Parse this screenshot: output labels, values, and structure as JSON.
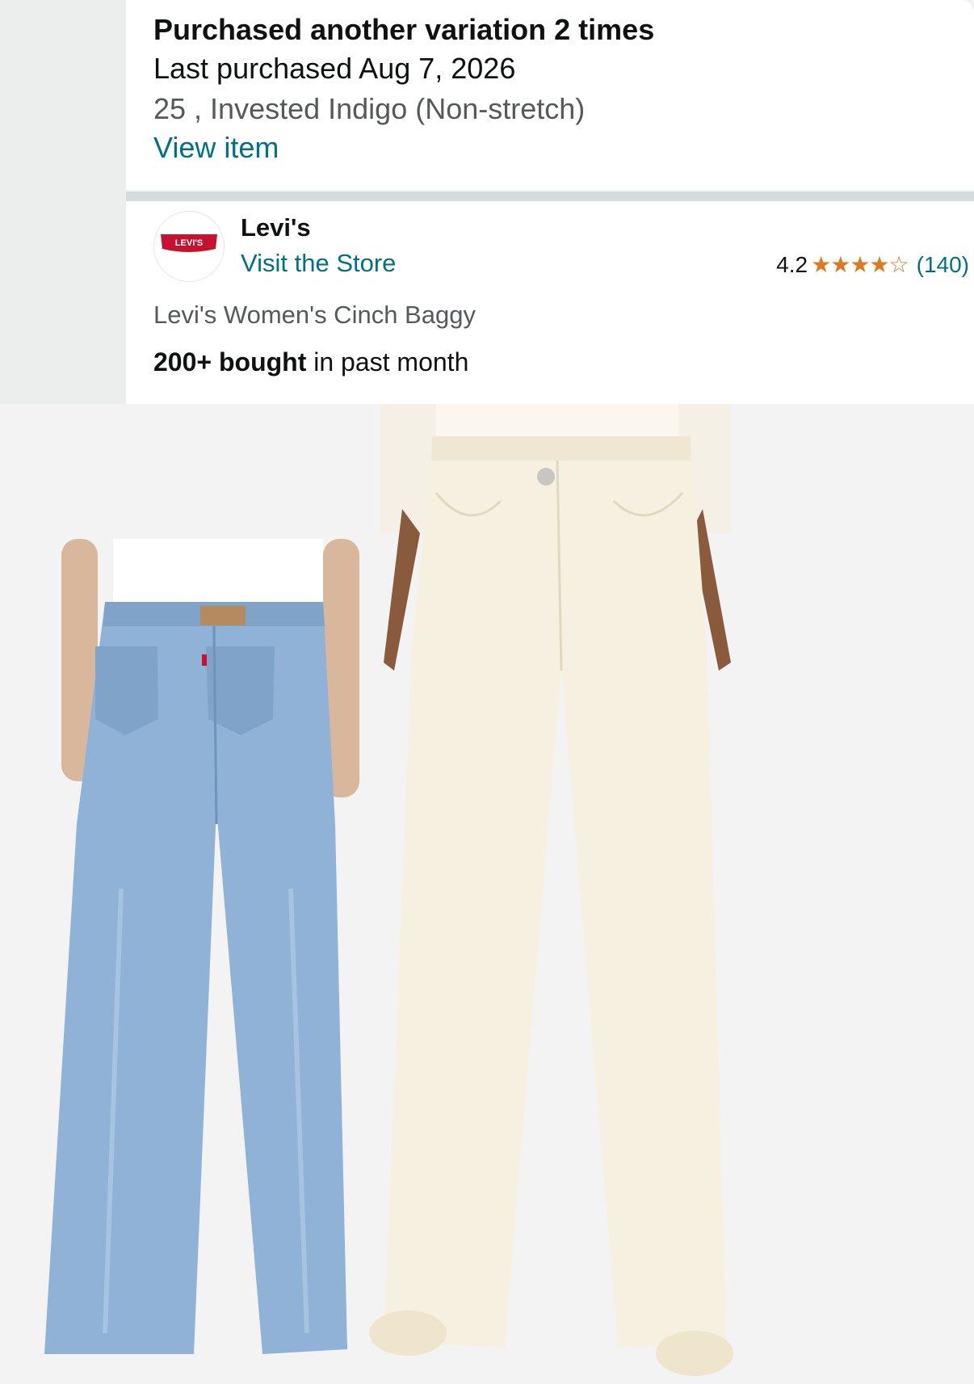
{
  "purchase_history": {
    "title": "Purchased another variation 2 times",
    "last_purchased": "Last purchased Aug 7, 2026",
    "variation": "25 , Invested Indigo (Non-stretch)",
    "view_item": "View item"
  },
  "store": {
    "logo_text": "LEVI'S",
    "brand": "Levi's",
    "visit_store": "Visit the Store"
  },
  "rating": {
    "value": "4.2",
    "stars": "★★★★☆",
    "stars_out_of_5": 4.2,
    "count": "(140)"
  },
  "product": {
    "title": "Levi's Women's Cinch Baggy",
    "bought_bold": "200+ bought",
    "bought_rest": " in past month"
  },
  "colors": {
    "link": "#007185",
    "star": "#de7921",
    "brand_red": "#c41230"
  }
}
